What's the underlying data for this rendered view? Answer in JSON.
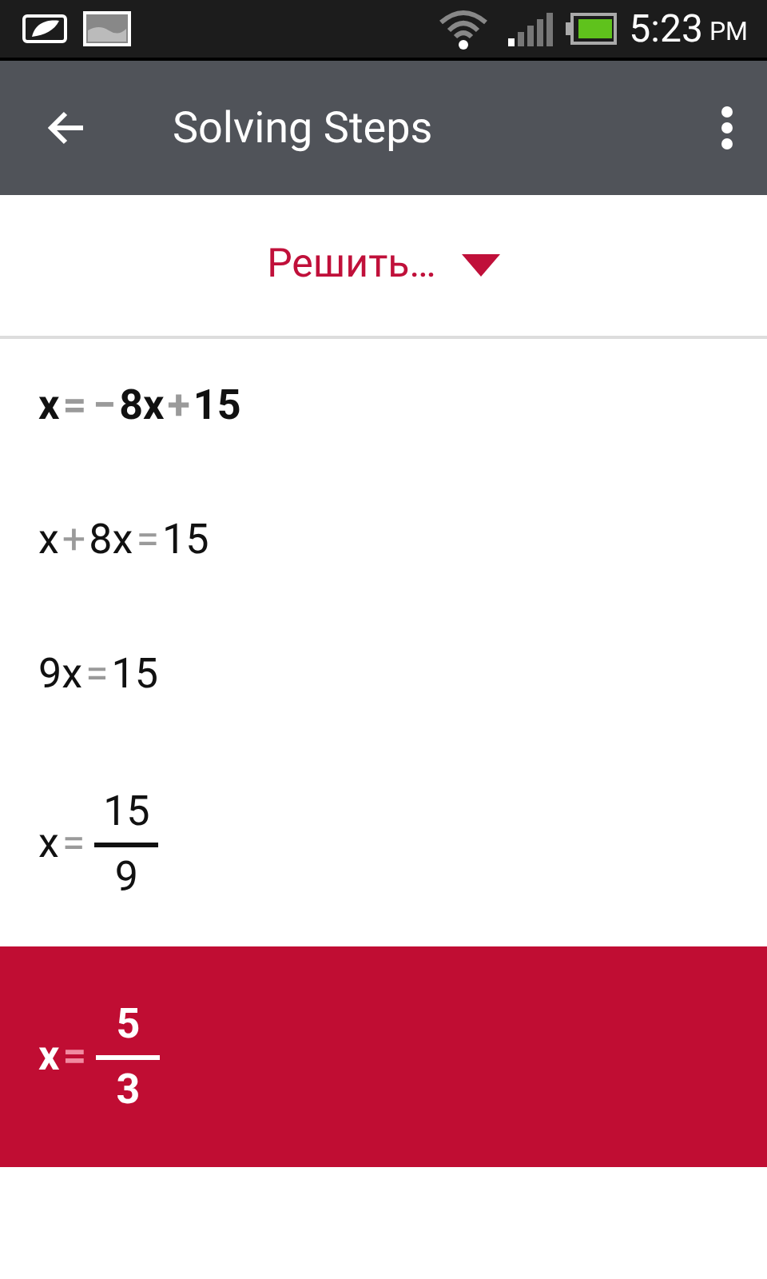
{
  "status_bar": {
    "time": "5:23",
    "ampm": "PM"
  },
  "app_bar": {
    "title": "Solving Steps"
  },
  "dropdown": {
    "label": "Решить…"
  },
  "steps": [
    {
      "kind": "problem",
      "selected": false,
      "tokens": [
        {
          "kind": "term",
          "text": "x"
        },
        {
          "kind": "op",
          "text": "="
        },
        {
          "kind": "op",
          "text": "−"
        },
        {
          "kind": "term",
          "text": "8x"
        },
        {
          "kind": "op",
          "text": "+"
        },
        {
          "kind": "term",
          "text": "15"
        }
      ]
    },
    {
      "kind": "step",
      "selected": false,
      "tokens": [
        {
          "kind": "term",
          "text": "x"
        },
        {
          "kind": "op",
          "text": "+"
        },
        {
          "kind": "term",
          "text": "8x"
        },
        {
          "kind": "op",
          "text": "="
        },
        {
          "kind": "term",
          "text": "15"
        }
      ]
    },
    {
      "kind": "step",
      "selected": false,
      "tokens": [
        {
          "kind": "term",
          "text": "9x"
        },
        {
          "kind": "op",
          "text": "="
        },
        {
          "kind": "term",
          "text": "15"
        }
      ]
    },
    {
      "kind": "step",
      "selected": false,
      "tokens": [
        {
          "kind": "term",
          "text": "x"
        },
        {
          "kind": "op",
          "text": "="
        },
        {
          "kind": "fraction",
          "numerator": "15",
          "denominator": "9"
        }
      ]
    },
    {
      "kind": "step",
      "selected": true,
      "tokens": [
        {
          "kind": "term",
          "text": "x"
        },
        {
          "kind": "op",
          "text": "="
        },
        {
          "kind": "fraction",
          "numerator": "5",
          "denominator": "3"
        }
      ]
    }
  ]
}
